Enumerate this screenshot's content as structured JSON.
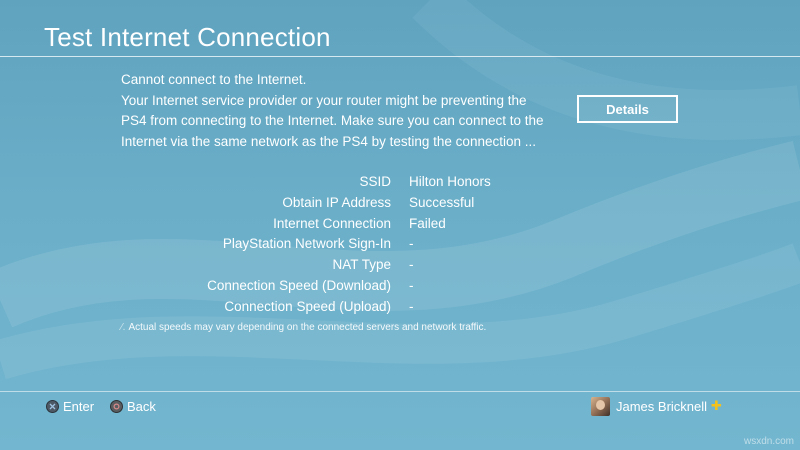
{
  "title": "Test Internet Connection",
  "message_lines": [
    "Cannot connect to the Internet.",
    "Your Internet service provider or your router might be preventing the",
    "PS4 from connecting to the Internet. Make sure you can connect to the",
    "Internet via the same network as the PS4 by testing the connection ..."
  ],
  "details_label": "Details",
  "results": [
    {
      "label": "SSID",
      "value": "Hilton Honors"
    },
    {
      "label": "Obtain IP Address",
      "value": "Successful"
    },
    {
      "label": "Internet Connection",
      "value": "Failed"
    },
    {
      "label": "PlayStation Network Sign-In",
      "value": "-"
    },
    {
      "label": "NAT Type",
      "value": "-"
    },
    {
      "label": "Connection Speed (Download)",
      "value": "-"
    },
    {
      "label": "Connection Speed (Upload)",
      "value": "-"
    }
  ],
  "footnote": "Actual speeds may vary depending on the connected servers and network traffic.",
  "footer": {
    "enter_label": "Enter",
    "back_label": "Back",
    "username": "James Bricknell",
    "enter_icon": "cross-button-icon",
    "back_icon": "circle-button-icon",
    "plus_icon": "playstation-plus-icon"
  },
  "watermark": "wsxdn.com",
  "colors": {
    "background": "#6aaec8",
    "text": "#ffffff",
    "plus": "#f4c21a"
  }
}
